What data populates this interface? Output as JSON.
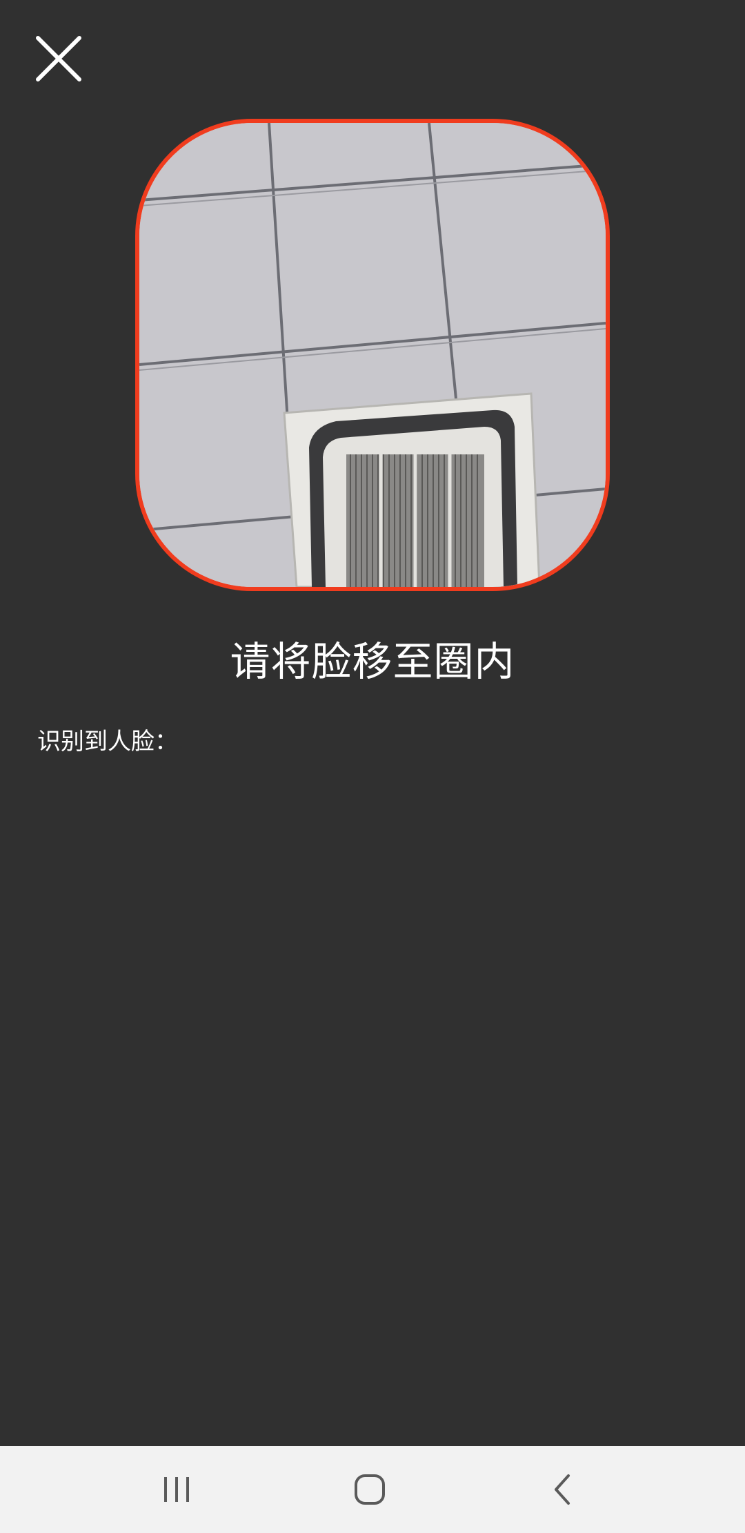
{
  "header": {
    "close_icon": "close-icon"
  },
  "camera": {
    "frame_color": "#f03c1e",
    "preview": "camera-preview"
  },
  "prompt": {
    "text": "请将脸移至圈内"
  },
  "detection": {
    "label": "识别到人脸："
  },
  "nav_bar": {
    "recents_icon": "recents-icon",
    "home_icon": "home-icon",
    "back_icon": "back-icon"
  }
}
